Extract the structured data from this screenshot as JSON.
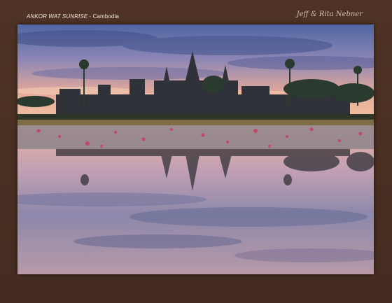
{
  "header": {
    "title_place": "ANKOR WAT SUNRISE",
    "title_separator": " - ",
    "title_country": "Cambodia",
    "signature": "Jeff & Rita Nebner"
  },
  "photo": {
    "subject": "Angkor Wat temple silhouette at sunrise reflected in a lotus pond",
    "colors": {
      "frame": "#4a2f22",
      "sky_top": "#5a6fa8",
      "sky_glow": "#f0b08a",
      "silhouette": "#2b2e33",
      "water": "#c6a9b8",
      "lotus": "#c2456a"
    }
  }
}
